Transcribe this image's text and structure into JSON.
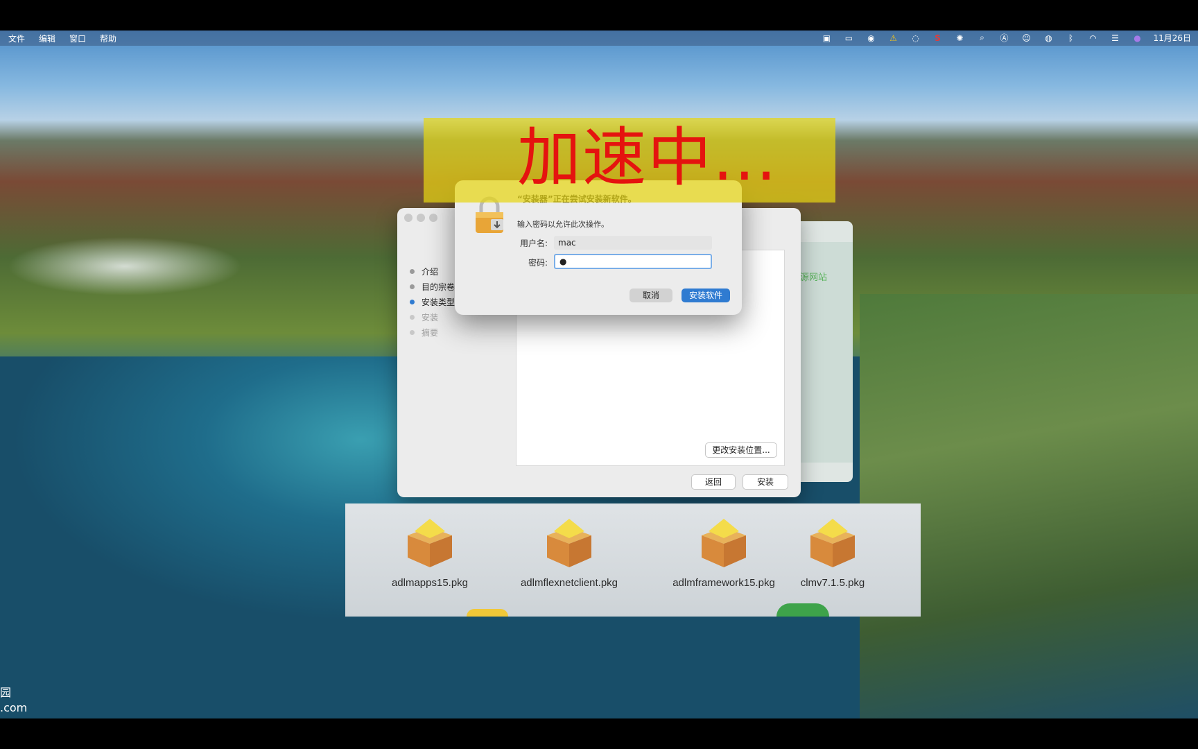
{
  "menubar": {
    "items": [
      "文件",
      "编辑",
      "窗口",
      "帮助"
    ],
    "date": "11月26日"
  },
  "banner": {
    "text": "加速中..."
  },
  "auth_dialog": {
    "title": "“安装器”正在尝试安装新软件。",
    "subtitle": "输入密码以允许此次操作。",
    "username_label": "用户名:",
    "username_value": "mac",
    "password_label": "密码:",
    "password_value": "●",
    "cancel_label": "取消",
    "install_label": "安装软件"
  },
  "installer": {
    "steps": [
      "介绍",
      "目的宗卷",
      "安装类型",
      "安装",
      "摘要"
    ],
    "active_step_index": 2,
    "change_location_label": "更改安装位置...",
    "back_label": "返回",
    "install_label": "安装"
  },
  "background_window": {
    "partial_text": "源网站"
  },
  "packages": [
    {
      "name": "adlmapps15.pkg"
    },
    {
      "name": "adlmflexnetclient.pkg"
    },
    {
      "name": "adlmframework15.pkg"
    },
    {
      "name": "clmv7.1.5.pkg"
    }
  ],
  "watermark": {
    "line1": "园",
    "line2": ".com"
  },
  "colors": {
    "accent": "#2f7bd1",
    "banner": "#e6d614",
    "banner_text": "#e5130f"
  }
}
